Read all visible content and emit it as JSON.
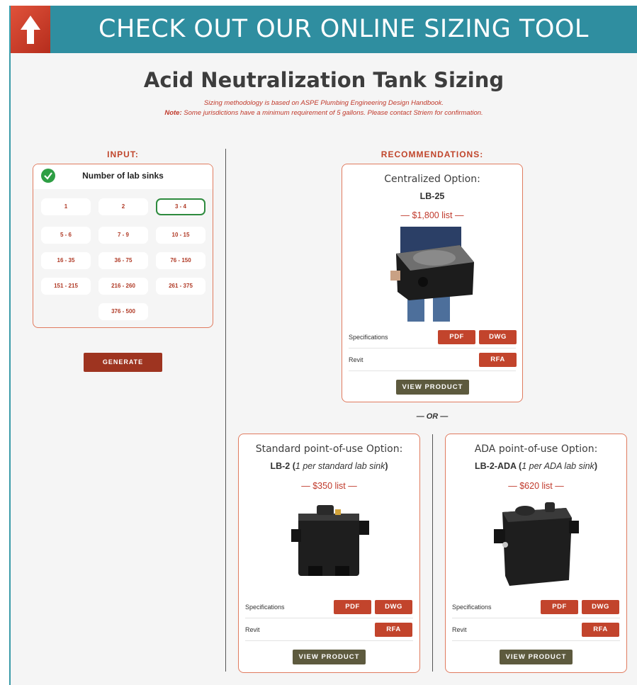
{
  "banner": {
    "title": "CHECK OUT OUR ONLINE SIZING TOOL"
  },
  "header": {
    "title": "Acid Neutralization Tank Sizing",
    "methodology": "Sizing methodology is based on ASPE Plumbing Engineering Design Handbook.",
    "note_label": "Note:",
    "note_text": " Some jurisdictions have a minimum requirement of 5 gallons. Please contact Striem for confirmation."
  },
  "input": {
    "section_label": "INPUT:",
    "card_title": "Number of lab sinks",
    "options": [
      "1",
      "2",
      "3 - 4",
      "5 - 6",
      "7 - 9",
      "10 - 15",
      "16 - 35",
      "36 - 75",
      "76 - 150",
      "151 - 215",
      "216 - 260",
      "261 - 375",
      "376 - 500"
    ],
    "selected": "3 - 4",
    "generate_label": "GENERATE"
  },
  "recommendations": {
    "section_label": "RECOMMENDATIONS:",
    "or_label": "— OR —",
    "centralized": {
      "title": "Centralized Option:",
      "model": "LB-25",
      "price": "— $1,800 list —",
      "spec_label": "Specifications",
      "revit_label": "Revit",
      "pdf": "PDF",
      "dwg": "DWG",
      "rfa": "RFA",
      "view": "VIEW PRODUCT"
    },
    "standard": {
      "title": "Standard point-of-use Option:",
      "model": "LB-2",
      "model_note": "1 per standard lab sink",
      "price": "— $350 list —",
      "spec_label": "Specifications",
      "revit_label": "Revit",
      "pdf": "PDF",
      "dwg": "DWG",
      "rfa": "RFA",
      "view": "VIEW PRODUCT"
    },
    "ada": {
      "title": "ADA point-of-use Option:",
      "model": "LB-2-ADA",
      "model_note": "1 per ADA lab sink",
      "price": "— $620 list —",
      "spec_label": "Specifications",
      "revit_label": "Revit",
      "pdf": "PDF",
      "dwg": "DWG",
      "rfa": "RFA",
      "view": "VIEW PRODUCT"
    }
  },
  "colors": {
    "banner": "#2f8ea0",
    "accent": "#c0392b",
    "selected_border": "#2e8b3e",
    "view_button": "#5d5a3e"
  }
}
